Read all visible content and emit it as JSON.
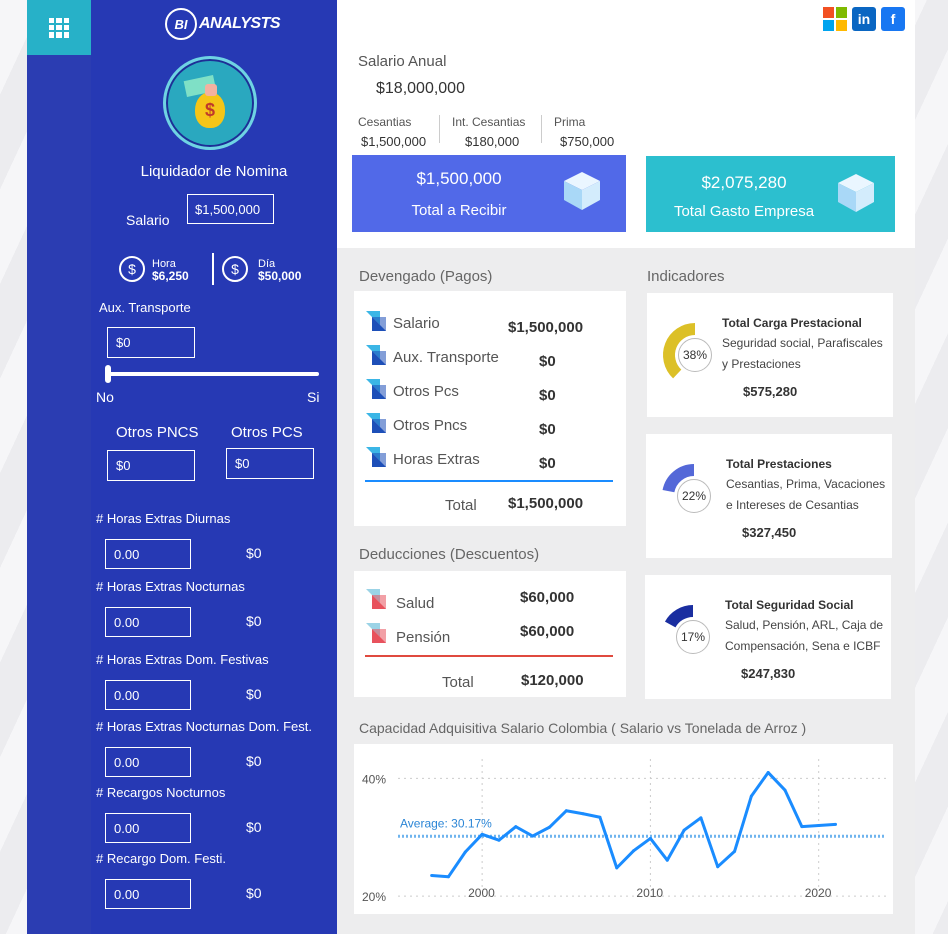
{
  "brand": {
    "logo_mark": "BI",
    "logo_text": "ANALYSTS",
    "title": "Liquidador de Nomina"
  },
  "sidebar": {
    "salario_label": "Salario",
    "salario_value": "$1,500,000",
    "hora_label": "Hora",
    "hora_value": "$6,250",
    "dia_label": "Día",
    "dia_value": "$50,000",
    "aux_label": "Aux. Transporte",
    "aux_value": "$0",
    "slider_no": "No",
    "slider_si": "Si",
    "slider_state": "No",
    "otros_pncs_label": "Otros PNCS",
    "otros_pncs_value": "$0",
    "otros_pcs_label": "Otros PCS",
    "otros_pcs_value": "$0",
    "extras": [
      {
        "label": "# Horas Extras Diurnas",
        "input": "0.00",
        "amount": "$0"
      },
      {
        "label": "# Horas Extras Nocturnas",
        "input": "0.00",
        "amount": "$0"
      },
      {
        "label": "# Horas Extras Dom. Festivas",
        "input": "0.00",
        "amount": "$0"
      },
      {
        "label": "# Horas Extras Nocturnas Dom. Fest.",
        "input": "0.00",
        "amount": "$0"
      },
      {
        "label": "# Recargos Nocturnos",
        "input": "0.00",
        "amount": "$0"
      },
      {
        "label": "# Recargo Dom. Festi.",
        "input": "0.00",
        "amount": "$0"
      }
    ]
  },
  "summary": {
    "salario_anual_label": "Salario Anual",
    "salario_anual_value": "$18,000,000",
    "cesantias_label": "Cesantias",
    "cesantias_value": "$1,500,000",
    "int_cesantias_label": "Int. Cesantias",
    "int_cesantias_value": "$180,000",
    "prima_label": "Prima",
    "prima_value": "$750,000",
    "total_recibir_value": "$1,500,000",
    "total_recibir_label": "Total a Recibir",
    "total_gasto_value": "$2,075,280",
    "total_gasto_label": "Total Gasto Empresa"
  },
  "devengado": {
    "title": "Devengado (Pagos)",
    "rows": [
      {
        "label": "Salario",
        "value": "$1,500,000"
      },
      {
        "label": "Aux. Transporte",
        "value": "$0"
      },
      {
        "label": "Otros Pcs",
        "value": "$0"
      },
      {
        "label": "Otros Pncs",
        "value": "$0"
      },
      {
        "label": "Horas Extras",
        "value": "$0"
      }
    ],
    "total_label": "Total",
    "total_value": "$1,500,000"
  },
  "deducciones": {
    "title": "Deducciones (Descuentos)",
    "rows": [
      {
        "label": "Salud",
        "value": "$60,000"
      },
      {
        "label": "Pensión",
        "value": "$60,000"
      }
    ],
    "total_label": "Total",
    "total_value": "$120,000"
  },
  "indicadores": {
    "title": "Indicadores",
    "items": [
      {
        "title": "Total Carga Prestacional",
        "desc1": "Seguridad social, Parafiscales",
        "desc2": "y Prestaciones",
        "value": "$575,280",
        "pct": "38%",
        "pct_num": 0.38,
        "color": "#dcc027"
      },
      {
        "title": "Total Prestaciones",
        "desc1": "Cesantias, Prima, Vacaciones",
        "desc2": "e Intereses de Cesantias",
        "value": "$327,450",
        "pct": "22%",
        "pct_num": 0.22,
        "color": "#5468d8"
      },
      {
        "title": "Total Seguridad Social",
        "desc1": "Salud, Pensión, ARL, Caja de",
        "desc2": "Compensación, Sena e ICBF",
        "value": "$247,830",
        "pct": "17%",
        "pct_num": 0.17,
        "color": "#1a2ea0"
      }
    ]
  },
  "chart_data": {
    "type": "line",
    "title": "Capacidad Adquisitiva Salario Colombia ( Salario vs Tonelada de Arroz )",
    "x": [
      1997,
      1998,
      1999,
      2000,
      2001,
      2002,
      2003,
      2004,
      2005,
      2006,
      2007,
      2008,
      2009,
      2010,
      2011,
      2012,
      2013,
      2014,
      2015,
      2016,
      2017,
      2018,
      2019,
      2020,
      2021
    ],
    "y": [
      23.5,
      23.3,
      27.5,
      30.5,
      29.5,
      31.8,
      30.2,
      31.7,
      34.5,
      34.0,
      33.4,
      24.8,
      27.7,
      29.8,
      26.1,
      31.2,
      33.3,
      25.0,
      27.6,
      37.0,
      41.0,
      38.0,
      31.8,
      32.0,
      32.2
    ],
    "series": [
      {
        "name": "Capacidad Adquisitiva",
        "color": "#1a8cff"
      }
    ],
    "average": 30.17,
    "average_label": "Average: 30.17%",
    "ytick_labels": [
      "40%",
      "20%"
    ],
    "yticks": [
      40,
      20
    ],
    "xticks": [
      2000,
      2010,
      2020
    ],
    "xlim": [
      1995,
      2024
    ],
    "ylim": [
      19,
      45
    ]
  }
}
